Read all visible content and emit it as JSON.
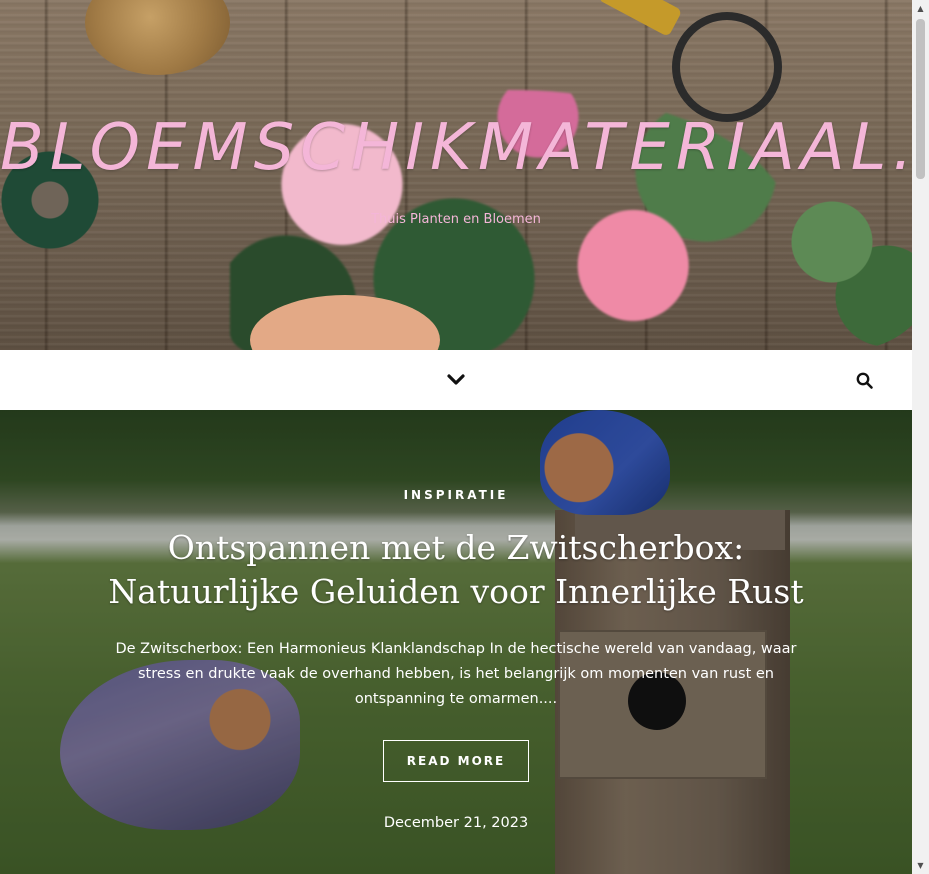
{
  "site": {
    "title": "BLOEMSCHIKMATERIAAL.",
    "tagline": "Thuis Planten en Bloemen",
    "title_color": "#f4b6d8"
  },
  "nav": {
    "menu_icon": "chevron-down-icon",
    "search_icon": "search-icon"
  },
  "featured_post": {
    "category": "INSPIRATIE",
    "title": "Ontspannen met de Zwitscherbox: Natuurlijke Geluiden voor Innerlijke Rust",
    "excerpt": "De Zwitscherbox: Een Harmonieus Klanklandschap In de hectische wereld van vandaag, waar stress en drukte vaak de overhand hebben, is het belangrijk om momenten van rust en ontspanning te omarmen....",
    "read_more_label": "READ MORE",
    "date": "December 21, 2023"
  }
}
